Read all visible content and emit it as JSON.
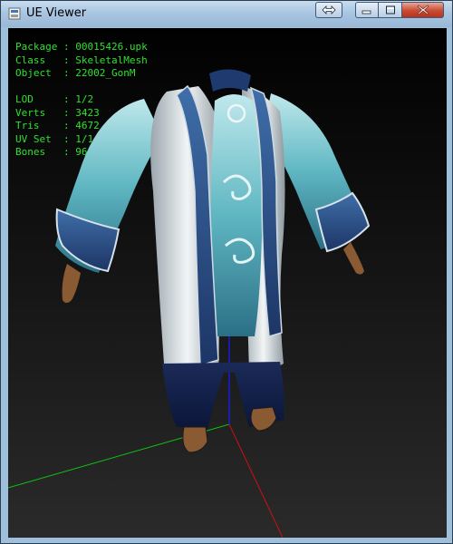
{
  "window": {
    "title": "UE Viewer"
  },
  "info": {
    "package_label": "Package",
    "package_value": "00015426.upk",
    "class_label": "Class",
    "class_value": "SkeletalMesh",
    "object_label": "Object",
    "object_value": "22002_GonM",
    "lod_label": "LOD",
    "lod_value": "1/2",
    "verts_label": "Verts",
    "verts_value": "3423",
    "tris_label": "Tris",
    "tris_value": "4672",
    "uvset_label": "UV Set",
    "uvset_value": "1/1",
    "bones_label": "Bones",
    "bones_value": "96"
  },
  "colors": {
    "info_text": "#2fe02f",
    "axis_x": "#d01010",
    "axis_y": "#10c010",
    "axis_z": "#1a1ae0"
  }
}
